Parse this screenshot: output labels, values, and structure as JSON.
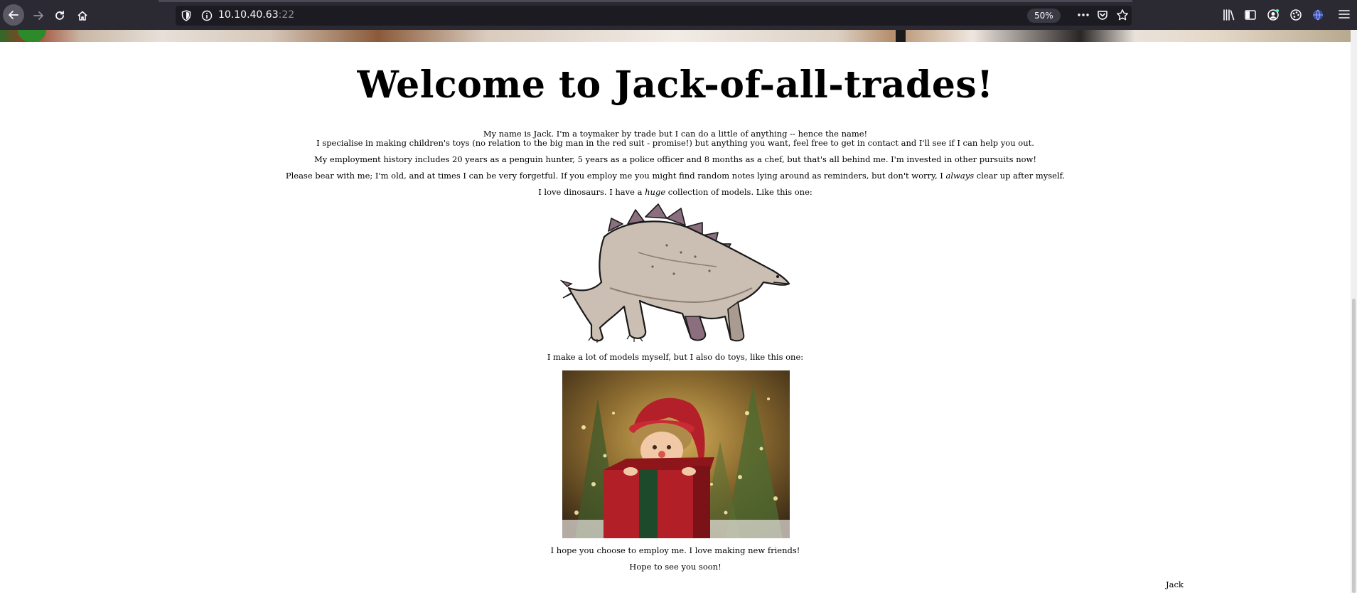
{
  "browser": {
    "url_host": "10.10.40.63",
    "url_port": ":22",
    "zoom": "50%"
  },
  "page": {
    "heading": "Welcome to Jack-of-all-trades!",
    "intro_line1": "My name is Jack. I'm a toymaker by trade but I can do a little of anything -- hence the name!",
    "intro_line2": "I specialise in making children's toys (no relation to the big man in the red suit - promise!) but anything you want, feel free to get in contact and I'll see if I can help you out.",
    "employment": "My employment history includes 20 years as a penguin hunter, 5 years as a police officer and 8 months as a chef, but that's all behind me. I'm invested in other pursuits now!",
    "forgetful_before": "Please bear with me; I'm old, and at times I can be very forgetful. If you employ me you might find random notes lying around as reminders, but don't worry, I ",
    "forgetful_em": "always",
    "forgetful_after": " clear up after myself.",
    "dino_before": "I love dinosaurs. I have a ",
    "dino_em": "huge",
    "dino_after": " collection of models. Like this one:",
    "toys_line": "I make a lot of models myself, but I also do toys, like this one:",
    "hope_employ": "I hope you choose to employ me. I love making new friends!",
    "see_you": "Hope to see you soon!",
    "signature": "Jack"
  },
  "colors": {
    "chrome_bg": "#2b2a33",
    "urlbar_bg": "#1c1b22",
    "page_bg": "#ffffff"
  }
}
